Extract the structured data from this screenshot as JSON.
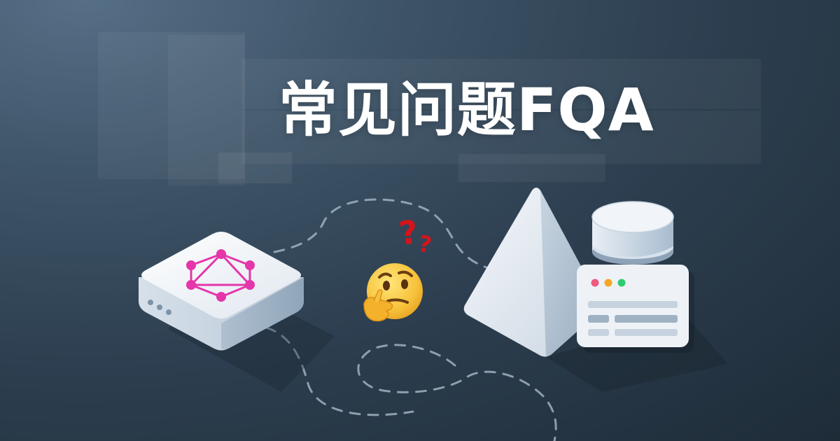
{
  "headline": "常见问题FQA",
  "icons": {
    "server": "graphql-server-icon",
    "thinking": "thinking-face-icon",
    "question": "question-marks-icon",
    "prisma": "prisma-pyramid-icon",
    "database": "database-icon",
    "browser": "browser-window-icon"
  },
  "colors": {
    "background": "#2d3f50",
    "graphql_pink": "#e535ab",
    "question_red": "#d6131b",
    "traffic_red": "#f05a7e",
    "traffic_yellow": "#f5a623",
    "traffic_green": "#2ecc71"
  }
}
